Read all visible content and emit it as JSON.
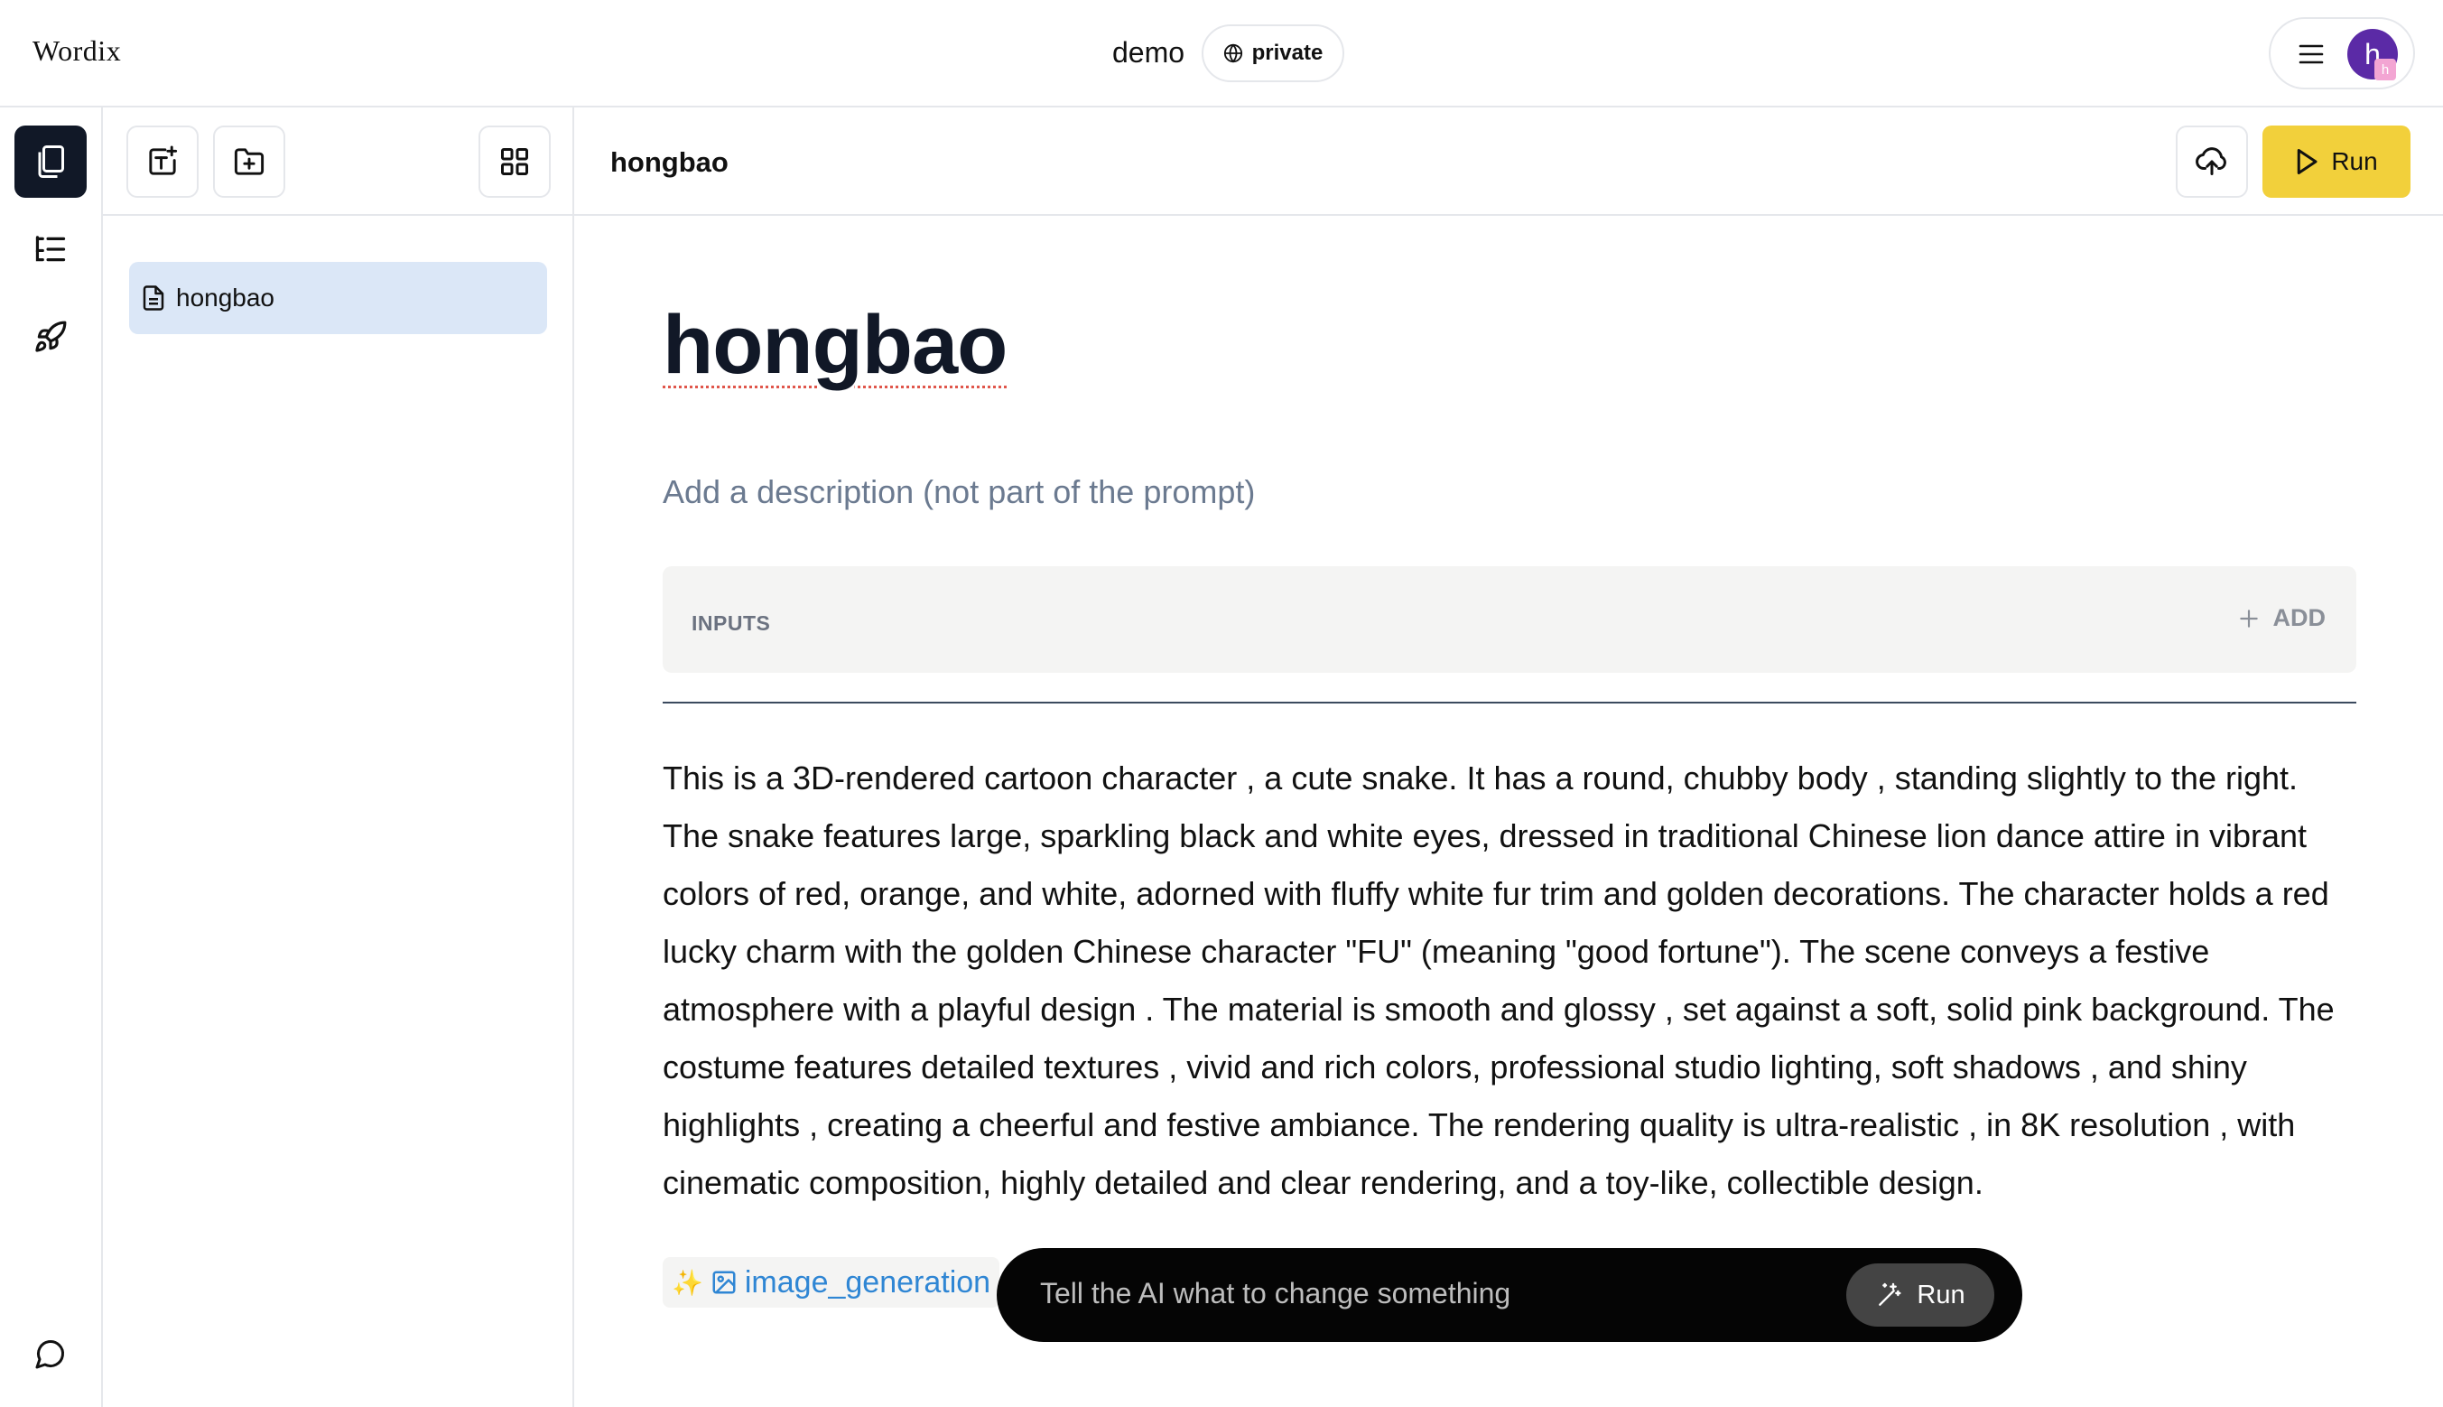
{
  "app": {
    "brand": "Wordix"
  },
  "header": {
    "project_name": "demo",
    "visibility": "private",
    "avatar_initial": "h",
    "avatar_badge": "h"
  },
  "file_panel": {
    "files": [
      {
        "name": "hongbao"
      }
    ]
  },
  "main": {
    "header_title": "hongbao",
    "run_label": "Run"
  },
  "document": {
    "title": "hongbao",
    "description_placeholder": "Add a description (not part of the prompt)",
    "inputs_label": "INPUTS",
    "add_label": "ADD",
    "body": "This is a 3D-rendered cartoon character , a cute snake. It has a round, chubby body , standing slightly to the right. The snake features large, sparkling black and white eyes, dressed in traditional Chinese lion dance attire in vibrant colors of red, orange, and white, adorned with fluffy white fur trim and golden decorations.  The character holds a red lucky charm with the golden Chinese character \"FU\" (meaning \"good fortune\"). The scene conveys a festive atmosphere with a playful design . The material is smooth and glossy , set against a soft, solid pink background. The costume features detailed textures , vivid and rich colors, professional studio lighting, soft shadows , and shiny highlights , creating a cheerful and festive ambiance.  The rendering quality is ultra-realistic , in 8K resolution , with cinematic composition, highly detailed and clear rendering, and a toy-like, collectible design.",
    "tag": {
      "sparkle": "✨",
      "label": "image_generation"
    }
  },
  "ai_bar": {
    "placeholder": "Tell the AI what to change something",
    "run_label": "Run"
  },
  "colors": {
    "run_button": "#f2d03b",
    "active_rail": "#111827",
    "selected_file": "#dbe7f7",
    "tag_text": "#2f86d4",
    "avatar": "#5b2aa6"
  }
}
